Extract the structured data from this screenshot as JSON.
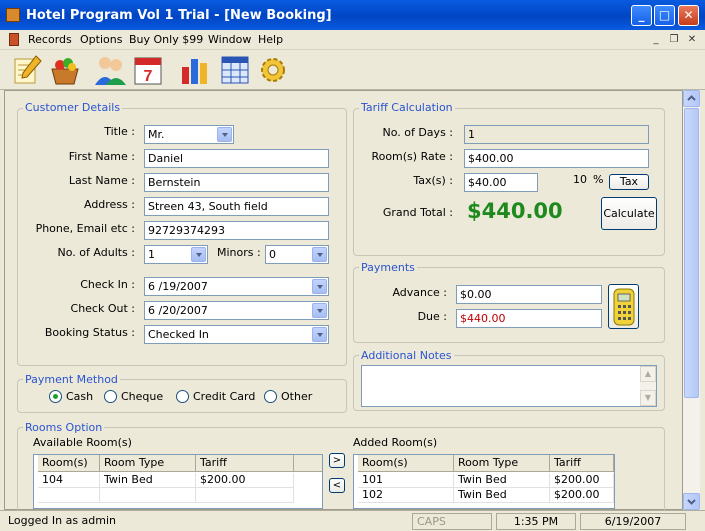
{
  "window": {
    "title": "Hotel Program Vol 1 Trial - [New Booking]"
  },
  "menu": [
    "Records",
    "Options",
    "Buy Only $99",
    "Window",
    "Help"
  ],
  "customer": {
    "legend": "Customer Details",
    "title_label": "Title :",
    "title_value": "Mr.",
    "first_name_label": "First Name :",
    "first_name": "Daniel",
    "last_name_label": "Last Name :",
    "last_name": "Bernstein",
    "address_label": "Address :",
    "address": "Streen 43, South field",
    "phone_label": "Phone, Email etc :",
    "phone": "92729374293",
    "adults_label": "No. of Adults :",
    "adults": "1",
    "minors_label": "Minors :",
    "minors": "0",
    "checkin_label": "Check In :",
    "checkin": "6 /19/2007",
    "checkout_label": "Check Out :",
    "checkout": "6 /20/2007",
    "status_label": "Booking Status :",
    "status": "Checked In"
  },
  "tariff": {
    "legend": "Tariff Calculation",
    "days_label": "No. of Days :",
    "days": "1",
    "rate_label": "Room(s) Rate :",
    "rate": "$400.00",
    "tax_label": "Tax(s) :",
    "tax": "$40.00",
    "tax_pct": "10",
    "pct_sign": "%",
    "tax_button": "Tax",
    "grand_total_label": "Grand Total :",
    "grand_total": "$440.00",
    "calculate_button": "Calculate",
    "grand_total_color": "#1E8A1E"
  },
  "payments": {
    "legend": "Payments",
    "advance_label": "Advance :",
    "advance": "$0.00",
    "due_label": "Due :",
    "due": "$440.00",
    "due_color": "#C00000"
  },
  "notes": {
    "legend": "Additional Notes",
    "value": ""
  },
  "payment_method": {
    "legend": "Payment Method",
    "options": [
      "Cash",
      "Cheque",
      "Credit Card",
      "Other"
    ],
    "selected": "Cash"
  },
  "rooms": {
    "legend": "Rooms Option",
    "available_label": "Available Room(s)",
    "added_label": "Added Room(s)",
    "columns": [
      "Room(s)",
      "Room Type",
      "Tariff"
    ],
    "available": [
      {
        "room": "104",
        "type": "Twin Bed",
        "tariff": "$200.00"
      }
    ],
    "added": [
      {
        "room": "101",
        "type": "Twin Bed",
        "tariff": "$200.00"
      },
      {
        "room": "102",
        "type": "Twin Bed",
        "tariff": "$200.00"
      }
    ],
    "move_right": ">",
    "move_left": "<"
  },
  "statusbar": {
    "user": "Logged In as admin",
    "caps": "CAPS",
    "time": "1:35 PM",
    "date": "6/19/2007"
  },
  "icons": {
    "toolbar": [
      "edit-icon",
      "fruit-basket-icon",
      "users-icon",
      "calendar-icon",
      "chart-icon",
      "table-icon",
      "gear-icon"
    ]
  }
}
